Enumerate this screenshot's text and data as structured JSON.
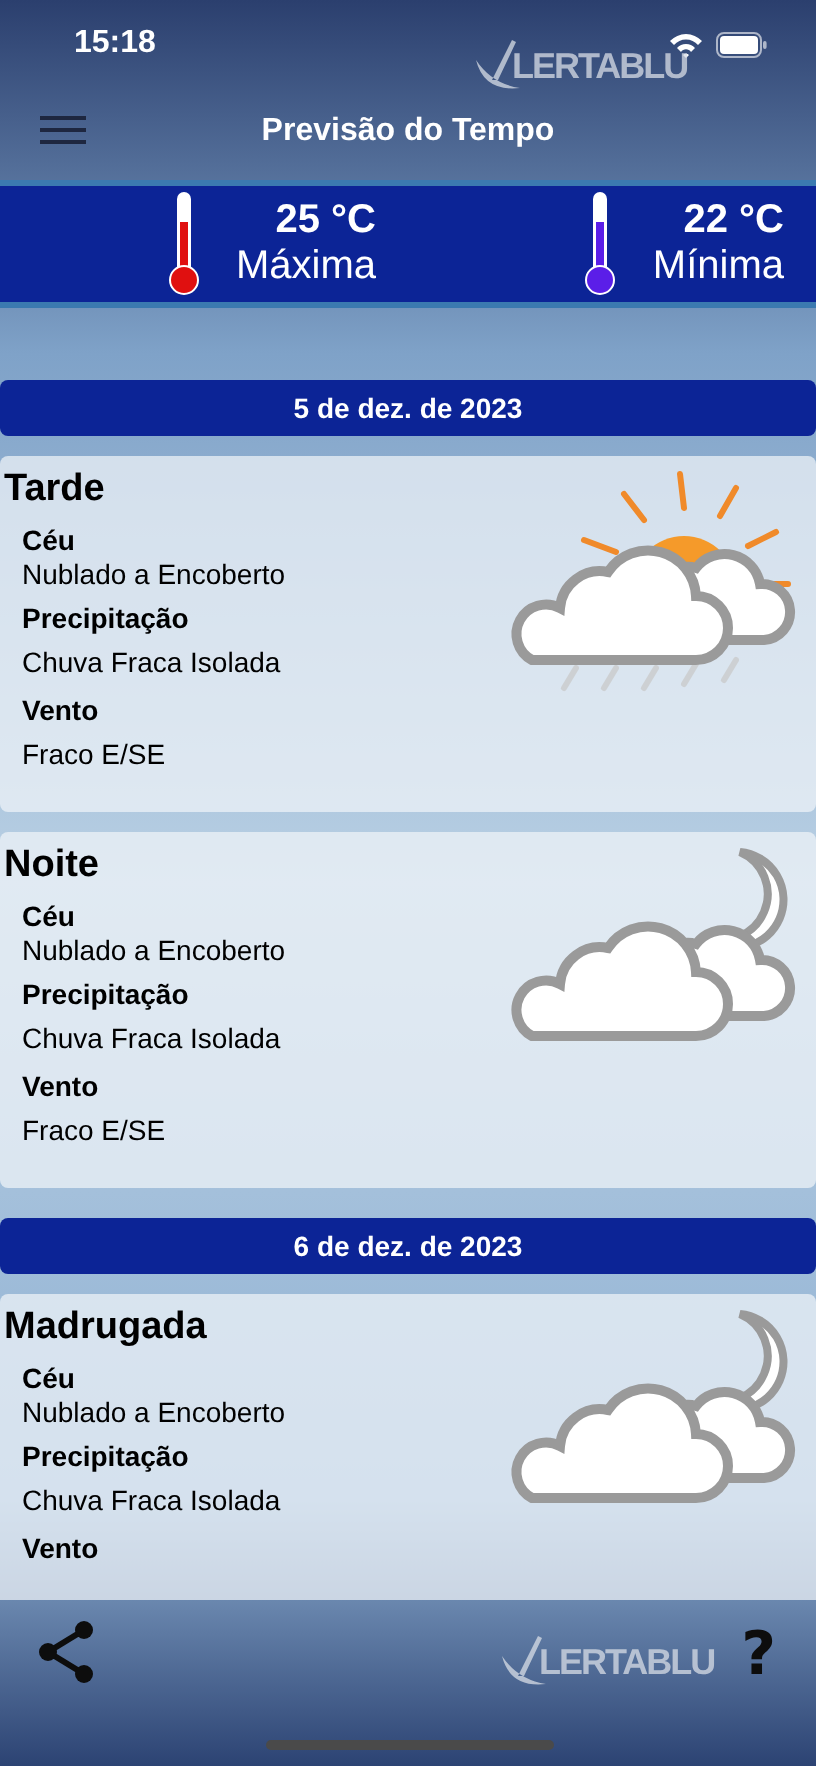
{
  "status_bar": {
    "time": "15:18"
  },
  "header": {
    "title": "Previsão do Tempo",
    "logo": "LERTABLU"
  },
  "temperatures": [
    {
      "kind": "max",
      "value": "25 °C",
      "label": "Máxima"
    },
    {
      "kind": "min",
      "value": "22 °C",
      "label": "Mínima"
    }
  ],
  "days": [
    {
      "date": "5 de dez. de 2023",
      "periods": [
        {
          "name": "Tarde",
          "kind": "sun-rain",
          "fields": [
            {
              "label": "Céu",
              "value": "Nublado a Encoberto"
            },
            {
              "label": "Precipitação",
              "value": "Chuva Fraca Isolada"
            },
            {
              "label": "Vento",
              "value": "Fraco E/SE"
            }
          ]
        },
        {
          "name": "Noite",
          "kind": "moon",
          "fields": [
            {
              "label": "Céu",
              "value": "Nublado a Encoberto"
            },
            {
              "label": "Precipitação",
              "value": "Chuva Fraca Isolada"
            },
            {
              "label": "Vento",
              "value": "Fraco E/SE"
            }
          ]
        }
      ]
    },
    {
      "date": "6 de dez. de 2023",
      "periods": [
        {
          "name": "Madrugada",
          "kind": "moon",
          "fields": [
            {
              "label": "Céu",
              "value": "Nublado a Encoberto"
            },
            {
              "label": "Precipitação",
              "value": "Chuva Fraca Isolada"
            },
            {
              "label": "Vento"
            }
          ]
        }
      ]
    }
  ],
  "footer": {
    "logo": "LERTABLU",
    "help": "?"
  }
}
